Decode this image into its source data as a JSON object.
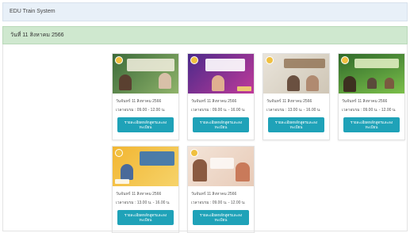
{
  "header": {
    "title": "EDU Train System"
  },
  "date_bar": {
    "text": "วันที่ 11 สิงหาคม 2566"
  },
  "cards": [
    {
      "date": "วันจันทร์ 11 สิงหาคม 2566",
      "time": "เวลาอบรม : 09.00 - 12.00 น.",
      "button": "รายละเอียดหลักสูตรและลงทะเบียน",
      "colors": [
        "#3c6b3a",
        "#8fb36a"
      ]
    },
    {
      "date": "วันจันทร์ 11 สิงหาคม 2566",
      "time": "เวลาอบรม : 09.00 น. - 16.00 น.",
      "button": "รายละเอียดหลักสูตรและลงทะเบียน",
      "colors": [
        "#4b2a8a",
        "#c03a9a"
      ]
    },
    {
      "date": "วันจันทร์ 11 สิงหาคม 2566",
      "time": "เวลาอบรม : 13.00 น. - 16.00 น.",
      "button": "รายละเอียดหลักสูตรและลงทะเบียน",
      "colors": [
        "#d9d3c7",
        "#8a6a4a"
      ]
    },
    {
      "date": "วันจันทร์ 11 สิงหาคม 2566",
      "time": "เวลาอบรม : 09.00 น. - 12.00 น.",
      "button": "รายละเอียดหลักสูตรและลงทะเบียน",
      "colors": [
        "#2f6a2a",
        "#7bbf4a"
      ]
    },
    {
      "date": "วันจันทร์ 11 สิงหาคม 2566",
      "time": "เวลาอบรม : 13.00 น. - 16.00 น.",
      "button": "รายละเอียดหลักสูตรและลงทะเบียน",
      "colors": [
        "#f2b632",
        "#2d6fb8"
      ]
    },
    {
      "date": "วันจันทร์ 11 สิงหาคม 2566",
      "time": "เวลาอบรม : 09.00 น. - 12.00 น.",
      "button": "รายละเอียดหลักสูตรและลงทะเบียน",
      "colors": [
        "#f3e4d8",
        "#c97a5a"
      ]
    }
  ],
  "accent": "#1fa2b8"
}
